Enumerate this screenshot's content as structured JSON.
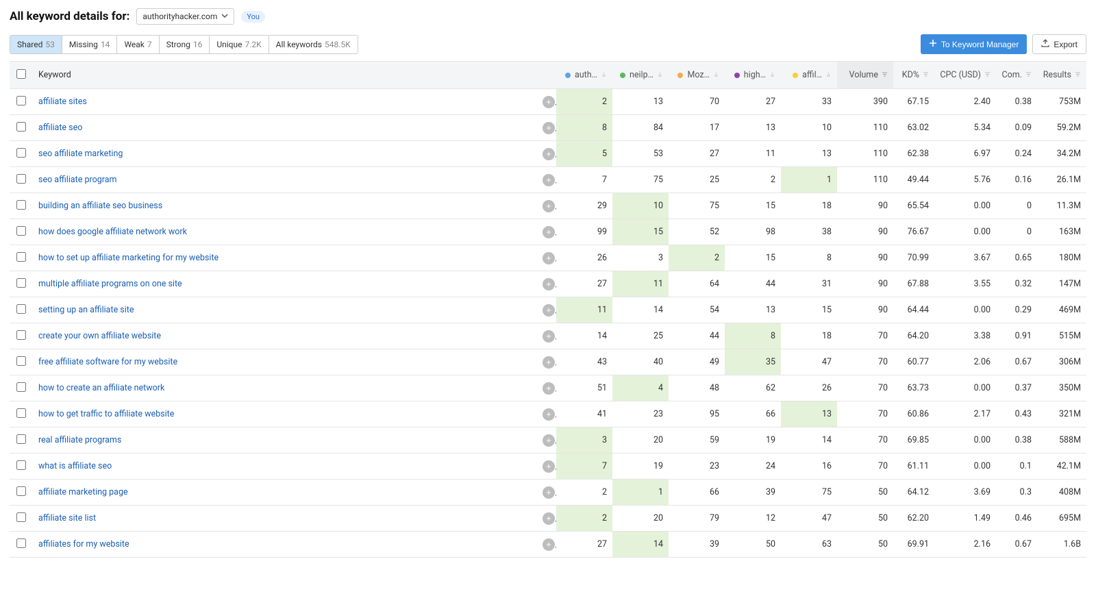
{
  "header": {
    "title_prefix": "All keyword details for:",
    "domain": "authorityhacker.com",
    "you_label": "You"
  },
  "tabs": [
    {
      "label": "Shared",
      "count": "53",
      "active": true
    },
    {
      "label": "Missing",
      "count": "14",
      "active": false
    },
    {
      "label": "Weak",
      "count": "7",
      "active": false
    },
    {
      "label": "Strong",
      "count": "16",
      "active": false
    },
    {
      "label": "Unique",
      "count": "7.2K",
      "active": false
    },
    {
      "label": "All keywords",
      "count": "548.5K",
      "active": false
    }
  ],
  "actions": {
    "to_manager": "To Keyword Manager",
    "export": "Export"
  },
  "columns": {
    "keyword": "Keyword",
    "competitors": [
      {
        "label": "auth…",
        "color": "blue"
      },
      {
        "label": "neilp…",
        "color": "green"
      },
      {
        "label": "Moz…",
        "color": "orange"
      },
      {
        "label": "high…",
        "color": "purple"
      },
      {
        "label": "affil…",
        "color": "yellow"
      }
    ],
    "volume": "Volume",
    "kd": "KD%",
    "cpc": "CPC (USD)",
    "com": "Com.",
    "results": "Results"
  },
  "rows": [
    {
      "keyword": "affiliate sites",
      "pos": [
        2,
        13,
        70,
        27,
        33
      ],
      "best": 0,
      "volume": "390",
      "kd": "67.15",
      "cpc": "2.40",
      "com": "0.38",
      "results": "753M"
    },
    {
      "keyword": "affiliate seo",
      "pos": [
        8,
        84,
        17,
        13,
        10
      ],
      "best": 0,
      "volume": "110",
      "kd": "63.02",
      "cpc": "5.34",
      "com": "0.09",
      "results": "59.2M"
    },
    {
      "keyword": "seo affiliate marketing",
      "pos": [
        5,
        53,
        27,
        11,
        13
      ],
      "best": 0,
      "volume": "110",
      "kd": "62.38",
      "cpc": "6.97",
      "com": "0.24",
      "results": "34.2M"
    },
    {
      "keyword": "seo affiliate program",
      "pos": [
        7,
        75,
        25,
        2,
        1
      ],
      "best": 4,
      "volume": "110",
      "kd": "49.44",
      "cpc": "5.76",
      "com": "0.16",
      "results": "26.1M"
    },
    {
      "keyword": "building an affiliate seo business",
      "pos": [
        29,
        10,
        75,
        15,
        18
      ],
      "best": 1,
      "volume": "90",
      "kd": "65.54",
      "cpc": "0.00",
      "com": "0",
      "results": "11.3M"
    },
    {
      "keyword": "how does google affiliate network work",
      "pos": [
        99,
        15,
        52,
        98,
        38
      ],
      "best": 1,
      "volume": "90",
      "kd": "76.67",
      "cpc": "0.00",
      "com": "0",
      "results": "163M"
    },
    {
      "keyword": "how to set up affiliate marketing for my website",
      "pos": [
        26,
        3,
        2,
        15,
        8
      ],
      "best": 2,
      "volume": "90",
      "kd": "70.99",
      "cpc": "3.67",
      "com": "0.65",
      "results": "180M"
    },
    {
      "keyword": "multiple affiliate programs on one site",
      "pos": [
        27,
        11,
        64,
        44,
        31
      ],
      "best": 1,
      "volume": "90",
      "kd": "67.88",
      "cpc": "3.55",
      "com": "0.32",
      "results": "147M"
    },
    {
      "keyword": "setting up an affiliate site",
      "pos": [
        11,
        14,
        54,
        13,
        15
      ],
      "best": 0,
      "volume": "90",
      "kd": "64.44",
      "cpc": "0.00",
      "com": "0.29",
      "results": "469M"
    },
    {
      "keyword": "create your own affiliate website",
      "pos": [
        14,
        25,
        44,
        8,
        18
      ],
      "best": 3,
      "volume": "70",
      "kd": "64.20",
      "cpc": "3.38",
      "com": "0.91",
      "results": "515M"
    },
    {
      "keyword": "free affiliate software for my website",
      "pos": [
        43,
        40,
        49,
        35,
        47
      ],
      "best": 3,
      "volume": "70",
      "kd": "60.77",
      "cpc": "2.06",
      "com": "0.67",
      "results": "306M"
    },
    {
      "keyword": "how to create an affiliate network",
      "pos": [
        51,
        4,
        48,
        62,
        26
      ],
      "best": 1,
      "volume": "70",
      "kd": "63.73",
      "cpc": "0.00",
      "com": "0.37",
      "results": "350M"
    },
    {
      "keyword": "how to get traffic to affiliate website",
      "pos": [
        41,
        23,
        95,
        66,
        13
      ],
      "best": 4,
      "volume": "70",
      "kd": "60.86",
      "cpc": "2.17",
      "com": "0.43",
      "results": "321M"
    },
    {
      "keyword": "real affiliate programs",
      "pos": [
        3,
        20,
        59,
        19,
        14
      ],
      "best": 0,
      "volume": "70",
      "kd": "69.85",
      "cpc": "0.00",
      "com": "0.38",
      "results": "588M"
    },
    {
      "keyword": "what is affiliate seo",
      "pos": [
        7,
        19,
        23,
        24,
        16
      ],
      "best": 0,
      "volume": "70",
      "kd": "61.11",
      "cpc": "0.00",
      "com": "0.1",
      "results": "42.1M"
    },
    {
      "keyword": "affiliate marketing page",
      "pos": [
        2,
        1,
        66,
        39,
        75
      ],
      "best": 1,
      "volume": "50",
      "kd": "64.12",
      "cpc": "3.69",
      "com": "0.3",
      "results": "408M"
    },
    {
      "keyword": "affiliate site list",
      "pos": [
        2,
        20,
        79,
        12,
        47
      ],
      "best": 0,
      "volume": "50",
      "kd": "62.20",
      "cpc": "1.49",
      "com": "0.46",
      "results": "695M"
    },
    {
      "keyword": "affiliates for my website",
      "pos": [
        27,
        14,
        39,
        50,
        63
      ],
      "best": 1,
      "volume": "50",
      "kd": "69.91",
      "cpc": "2.16",
      "com": "0.67",
      "results": "1.6B"
    }
  ]
}
